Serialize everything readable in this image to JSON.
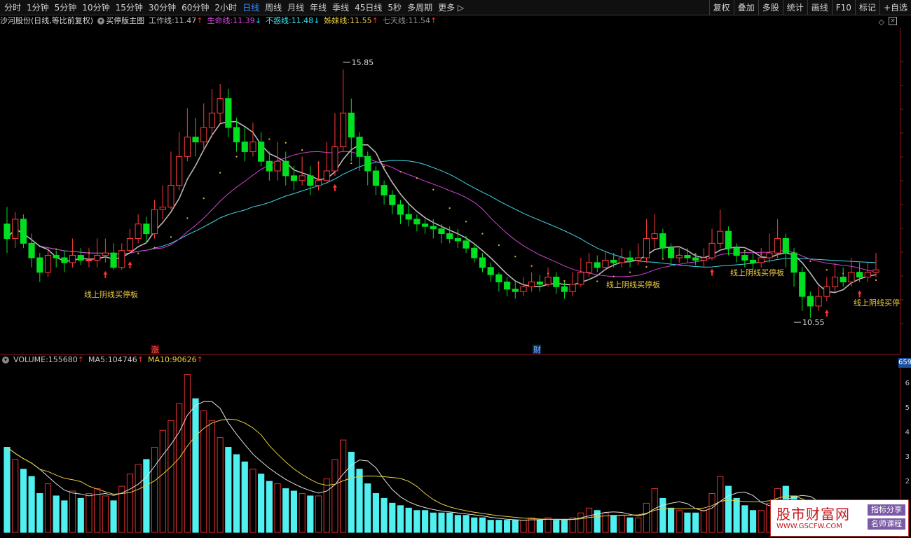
{
  "toolbar": {
    "periods": [
      "分时",
      "1分钟",
      "5分钟",
      "10分钟",
      "15分钟",
      "30分钟",
      "60分钟",
      "2小时",
      "日线",
      "周线",
      "月线",
      "年线",
      "季线",
      "45日线",
      "5秒",
      "多周期"
    ],
    "active": "日线",
    "more": "更多 ▷",
    "right": [
      "复权",
      "叠加",
      "多股",
      "统计",
      "画线",
      "F10",
      "标记",
      "+自选"
    ]
  },
  "main_legend": {
    "stock": "沙河股份(日线,等比前复权)",
    "indicator": "买停版主图",
    "lines": [
      {
        "label": "工作线:",
        "value": "11.47",
        "arrow": "↑",
        "color": "#c0c0c0",
        "arrow_color": "#ff3030"
      },
      {
        "label": "生命线:",
        "value": "11.39",
        "arrow": "↓",
        "color": "#e040e0",
        "arrow_color": "#00e5ff"
      },
      {
        "label": "不惑线:",
        "value": "11.48",
        "arrow": "↓",
        "color": "#40e0f0",
        "arrow_color": "#00e5ff"
      },
      {
        "label": "姊妹线:",
        "value": "11.55",
        "arrow": "↑",
        "color": "#e8c840",
        "arrow_color": "#ff3030"
      },
      {
        "label": "七天线:",
        "value": "11.54",
        "arrow": "↑",
        "color": "#909090",
        "arrow_color": "#ff3030"
      }
    ]
  },
  "annotations": {
    "high": "15.85",
    "low": "10.55",
    "buy_label": "线上阴线买停板",
    "buy_label_cut": "线上阴线买停",
    "zhang": "涨",
    "cai": "财"
  },
  "volume_legend": {
    "items": [
      {
        "label": "VOLUME:",
        "value": "155680",
        "arrow": "↑",
        "color": "#c8c8c8"
      },
      {
        "label": "MA5:",
        "value": "104746",
        "arrow": "↑",
        "color": "#c8c8c8"
      },
      {
        "label": "MA10:",
        "value": "90626",
        "arrow": "↑",
        "color": "#e8d040"
      }
    ],
    "badge": "659",
    "axis_ticks": [
      "6",
      "5",
      "4",
      "3",
      "2"
    ]
  },
  "colors": {
    "up": "#ff3c3c",
    "down": "#00e020",
    "vol_up": "#e03030",
    "vol_down": "#50f0f0",
    "ma_work": "#b8b8b8",
    "ma_life": "#d040d0",
    "ma_never": "#40d8e8",
    "sister": "#e8b040"
  },
  "watermark": {
    "title": "股市财富网",
    "url": "WWW.GSCFW.COM",
    "tag1": "指标分享",
    "tag2": "名师课程"
  },
  "chart_data": {
    "type": "candlestick",
    "y_range": [
      10.0,
      16.3
    ],
    "candles": [
      [
        12.5,
        12.2,
        12.85,
        11.9
      ],
      [
        12.2,
        12.6,
        12.75,
        12.0
      ],
      [
        12.6,
        12.1,
        12.7,
        12.0
      ],
      [
        12.1,
        11.8,
        12.3,
        11.6
      ],
      [
        11.8,
        11.5,
        11.9,
        11.3
      ],
      [
        11.5,
        11.85,
        12.0,
        11.4
      ],
      [
        11.85,
        11.8,
        11.95,
        11.6
      ],
      [
        11.8,
        11.7,
        11.95,
        11.5
      ],
      [
        11.7,
        11.85,
        12.2,
        11.6
      ],
      [
        11.85,
        11.75,
        12.0,
        11.65
      ],
      [
        11.75,
        11.75,
        12.0,
        11.6
      ],
      [
        11.75,
        11.85,
        12.2,
        11.6
      ],
      [
        11.85,
        11.9,
        12.2,
        11.7
      ],
      [
        11.9,
        11.6,
        12.1,
        11.55
      ],
      [
        11.6,
        11.95,
        12.1,
        11.55
      ],
      [
        11.95,
        12.2,
        12.4,
        11.9
      ],
      [
        12.2,
        12.5,
        12.7,
        12.1
      ],
      [
        12.5,
        12.3,
        12.65,
        12.1
      ],
      [
        12.3,
        12.8,
        13.0,
        12.2
      ],
      [
        12.8,
        12.85,
        13.3,
        12.6
      ],
      [
        12.85,
        13.3,
        14.0,
        12.8
      ],
      [
        13.3,
        13.9,
        14.4,
        13.2
      ],
      [
        13.9,
        14.3,
        14.9,
        13.8
      ],
      [
        14.3,
        14.2,
        14.7,
        13.9
      ],
      [
        14.2,
        14.5,
        15.0,
        14.0
      ],
      [
        14.5,
        14.8,
        15.3,
        14.3
      ],
      [
        14.8,
        15.1,
        15.4,
        14.6
      ],
      [
        15.1,
        14.5,
        15.3,
        14.3
      ],
      [
        14.5,
        14.2,
        14.7,
        14.0
      ],
      [
        14.2,
        14.0,
        14.5,
        13.8
      ],
      [
        14.0,
        14.2,
        14.6,
        13.9
      ],
      [
        14.2,
        13.8,
        14.4,
        13.7
      ],
      [
        13.8,
        13.6,
        14.0,
        13.4
      ],
      [
        13.6,
        13.8,
        14.2,
        13.4
      ],
      [
        13.8,
        13.5,
        14.0,
        13.3
      ],
      [
        13.5,
        13.4,
        13.7,
        13.2
      ],
      [
        13.4,
        13.5,
        13.9,
        13.3
      ],
      [
        13.5,
        13.3,
        13.7,
        13.1
      ],
      [
        13.3,
        13.4,
        13.8,
        13.2
      ],
      [
        13.4,
        13.6,
        14.2,
        13.4
      ],
      [
        13.6,
        14.1,
        14.8,
        13.5
      ],
      [
        14.1,
        14.8,
        15.7,
        14.0
      ],
      [
        14.8,
        14.3,
        15.1,
        13.8
      ],
      [
        14.3,
        13.9,
        14.4,
        13.6
      ],
      [
        13.9,
        13.6,
        14.0,
        13.3
      ],
      [
        13.6,
        13.3,
        13.7,
        13.1
      ],
      [
        13.3,
        13.1,
        13.4,
        12.9
      ],
      [
        13.1,
        12.9,
        13.2,
        12.7
      ],
      [
        12.9,
        12.7,
        13.0,
        12.5
      ],
      [
        12.7,
        12.6,
        12.9,
        12.45
      ],
      [
        12.6,
        12.5,
        12.7,
        12.35
      ],
      [
        12.5,
        12.45,
        12.6,
        12.3
      ],
      [
        12.45,
        12.4,
        12.6,
        12.2
      ],
      [
        12.4,
        12.3,
        12.5,
        12.1
      ],
      [
        12.3,
        12.2,
        12.45,
        12.1
      ],
      [
        12.2,
        12.15,
        12.4,
        12.0
      ],
      [
        12.15,
        12.0,
        12.25,
        11.9
      ],
      [
        12.0,
        11.8,
        12.1,
        11.7
      ],
      [
        11.8,
        11.6,
        11.9,
        11.5
      ],
      [
        11.6,
        11.45,
        11.7,
        11.3
      ],
      [
        11.45,
        11.3,
        11.5,
        11.1
      ],
      [
        11.3,
        11.15,
        11.4,
        11.0
      ],
      [
        11.15,
        11.1,
        11.3,
        10.95
      ],
      [
        11.1,
        11.2,
        11.4,
        11.0
      ],
      [
        11.2,
        11.3,
        11.5,
        11.1
      ],
      [
        11.3,
        11.25,
        11.45,
        11.1
      ],
      [
        11.25,
        11.4,
        11.6,
        11.2
      ],
      [
        11.4,
        11.2,
        11.5,
        11.05
      ],
      [
        11.2,
        11.1,
        11.3,
        10.95
      ],
      [
        11.1,
        11.25,
        11.5,
        11.0
      ],
      [
        11.25,
        11.5,
        11.8,
        11.2
      ],
      [
        11.5,
        11.7,
        11.9,
        11.4
      ],
      [
        11.7,
        11.6,
        11.85,
        11.5
      ],
      [
        11.6,
        11.75,
        11.95,
        11.55
      ],
      [
        11.75,
        11.7,
        11.9,
        11.6
      ],
      [
        11.7,
        11.8,
        12.0,
        11.6
      ],
      [
        11.8,
        11.75,
        11.95,
        11.6
      ],
      [
        11.75,
        11.8,
        12.1,
        11.65
      ],
      [
        11.8,
        12.2,
        12.6,
        11.7
      ],
      [
        12.2,
        12.3,
        12.7,
        12.0
      ],
      [
        12.3,
        12.0,
        12.4,
        11.8
      ],
      [
        12.0,
        11.8,
        12.1,
        11.65
      ],
      [
        11.8,
        11.85,
        12.0,
        11.7
      ],
      [
        11.85,
        11.8,
        12.0,
        11.7
      ],
      [
        11.8,
        11.75,
        11.9,
        11.65
      ],
      [
        11.75,
        11.8,
        12.0,
        11.6
      ],
      [
        11.8,
        12.1,
        12.4,
        11.75
      ],
      [
        12.1,
        12.35,
        12.8,
        12.0
      ],
      [
        12.35,
        12.0,
        12.45,
        11.85
      ],
      [
        12.0,
        11.85,
        12.1,
        11.7
      ],
      [
        11.85,
        11.75,
        11.95,
        11.6
      ],
      [
        11.75,
        11.7,
        11.9,
        11.55
      ],
      [
        11.7,
        11.8,
        12.0,
        11.6
      ],
      [
        11.8,
        11.9,
        12.3,
        11.7
      ],
      [
        11.9,
        12.2,
        12.6,
        11.8
      ],
      [
        12.2,
        11.9,
        12.3,
        11.6
      ],
      [
        11.9,
        11.5,
        12.0,
        11.2
      ],
      [
        11.5,
        11.0,
        11.6,
        10.7
      ],
      [
        11.0,
        10.8,
        11.1,
        10.55
      ],
      [
        10.8,
        11.0,
        11.2,
        10.7
      ],
      [
        11.0,
        11.2,
        11.4,
        10.9
      ],
      [
        11.2,
        11.4,
        11.7,
        11.1
      ],
      [
        11.4,
        11.3,
        11.6,
        11.2
      ],
      [
        11.3,
        11.5,
        11.8,
        11.2
      ],
      [
        11.5,
        11.4,
        11.7,
        11.3
      ],
      [
        11.4,
        11.5,
        11.7,
        11.3
      ],
      [
        11.5,
        11.55,
        11.9,
        11.4
      ]
    ],
    "volumes": [
      3.5,
      3.0,
      2.6,
      2.3,
      1.6,
      2.0,
      1.5,
      1.3,
      1.7,
      1.4,
      1.6,
      1.8,
      1.5,
      1.3,
      1.9,
      2.4,
      2.8,
      3.0,
      3.5,
      4.2,
      4.6,
      5.3,
      6.5,
      5.5,
      5.0,
      4.6,
      3.9,
      3.5,
      3.2,
      2.9,
      2.6,
      2.4,
      2.1,
      2.0,
      1.8,
      1.7,
      1.6,
      1.5,
      1.5,
      2.2,
      3.0,
      3.8,
      3.3,
      2.6,
      2.0,
      1.6,
      1.4,
      1.2,
      1.1,
      1.0,
      0.9,
      0.9,
      0.8,
      0.8,
      0.8,
      0.7,
      0.7,
      0.6,
      0.6,
      0.5,
      0.5,
      0.5,
      0.5,
      0.5,
      0.6,
      0.5,
      0.6,
      0.5,
      0.5,
      0.6,
      0.8,
      1.0,
      0.9,
      0.8,
      0.7,
      0.7,
      0.6,
      0.6,
      1.2,
      1.8,
      1.4,
      1.0,
      0.9,
      0.8,
      0.8,
      0.9,
      1.6,
      2.3,
      1.9,
      1.4,
      1.1,
      0.9,
      0.9,
      1.2,
      1.8,
      1.9,
      1.5,
      1.2,
      1.0,
      0.8,
      0.9,
      1.0,
      0.9,
      1.0,
      0.9,
      0.8,
      1.0
    ],
    "volume_range": [
      0,
      6.8
    ]
  }
}
